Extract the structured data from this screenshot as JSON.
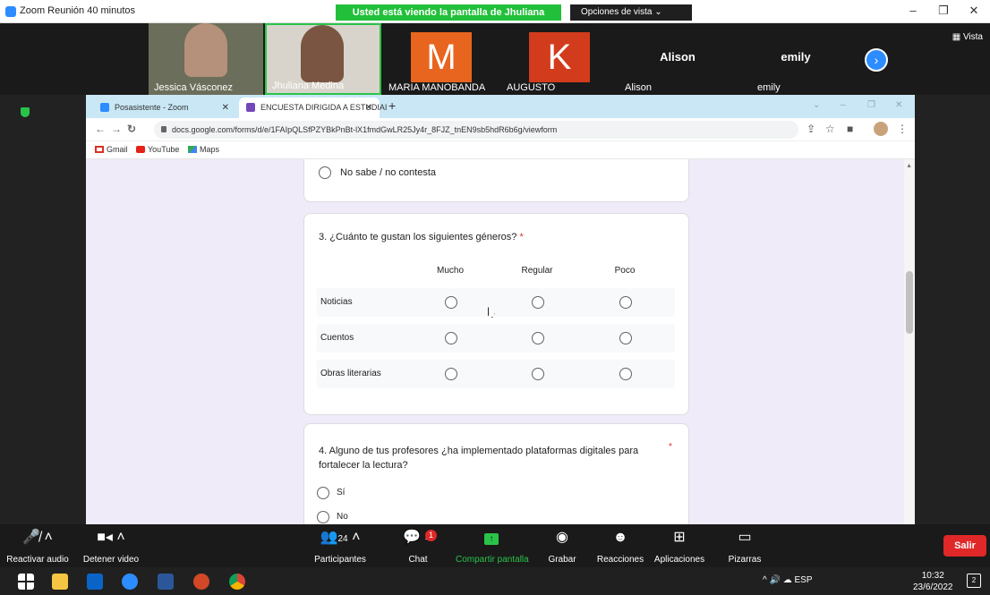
{
  "zoom": {
    "window_title": "Zoom Reunión 40 minutos",
    "share_banner": "Usted está viendo la pantalla de Jhuliana Medina",
    "view_options": "Opciones de vista ⌄",
    "vista": "▦ Vista",
    "participants": [
      {
        "name": "Jessica Vásconez",
        "type": "video",
        "bg": "#6b6e5a"
      },
      {
        "name": "Jhuliana Medina",
        "type": "video",
        "bg": "#d8d4cb"
      },
      {
        "name": "MARIA MANOBANDA",
        "type": "initial",
        "initial": "M",
        "color": "#e8651f"
      },
      {
        "name": "AUGUSTO",
        "type": "initial",
        "initial": "K",
        "color": "#d23c1c"
      },
      {
        "name": "Alison",
        "type": "name",
        "bigname": "Alison"
      },
      {
        "name": "emily",
        "type": "name",
        "bigname": "emily"
      }
    ],
    "toolbar": {
      "audio": "Reactivar audio",
      "video": "Detener video",
      "participants": "Participantes",
      "participants_count": "24",
      "chat": "Chat",
      "chat_badge": "1",
      "share": "Compartir pantalla",
      "record": "Grabar",
      "reactions": "Reacciones",
      "apps": "Aplicaciones",
      "whiteboards": "Pizarras",
      "leave": "Salir"
    }
  },
  "browser": {
    "tabs": [
      {
        "label": "Posasistente - Zoom",
        "active": false
      },
      {
        "label": "ENCUESTA DIRIGIDA A ESTUDIAI",
        "active": true
      }
    ],
    "url": "docs.google.com/forms/d/e/1FAIpQLSfPZYBkPnBt-lX1fmdGwLR25Jy4r_8FJZ_tnEN9sb5hdR6b6g/viewform",
    "bookmarks": [
      "Gmail",
      "YouTube",
      "Maps"
    ]
  },
  "form": {
    "q2_last_option": "No sabe / no contesta",
    "q3": {
      "title": "3. ¿Cuánto te gustan los siguientes géneros?",
      "required_mark": "*",
      "columns": [
        "Mucho",
        "Regular",
        "Poco"
      ],
      "rows": [
        "Noticias",
        "Cuentos",
        "Obras literarias"
      ]
    },
    "q4": {
      "title": "4.   Alguno de tus profesores ¿ha implementado plataformas digitales para fortalecer la lectura?",
      "required_mark": "*",
      "options": [
        "Sí",
        "No"
      ]
    }
  },
  "taskbar": {
    "tray_text": "^  🔊  ☁  ESP",
    "time": "10:32",
    "date": "23/6/2022",
    "notifications": "2"
  },
  "colors": {
    "zoom_green": "#22c03a",
    "zoom_blue": "#2d8cff",
    "leave_red": "#e02828",
    "forms_bg": "#f0ebf8"
  }
}
